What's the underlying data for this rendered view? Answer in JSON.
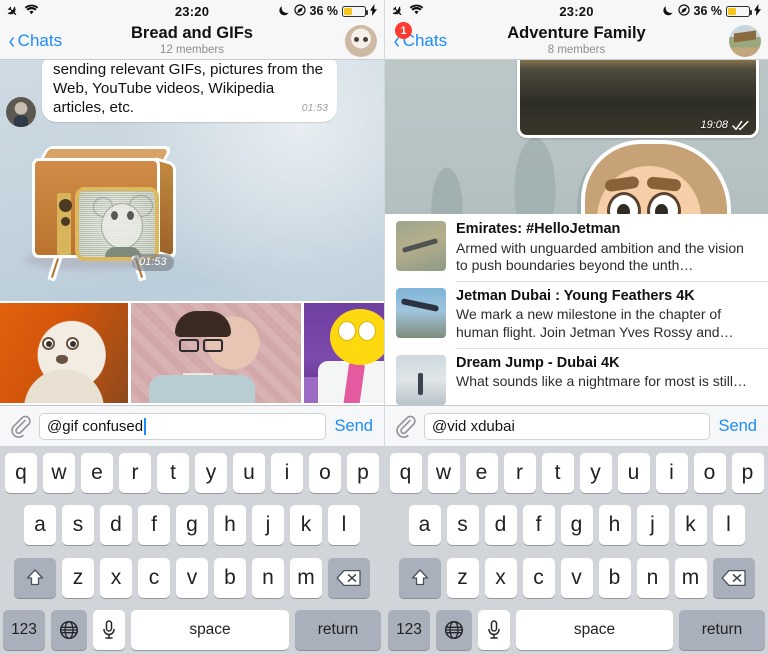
{
  "status_bar": {
    "airplane_icon": "airplane-icon",
    "wifi_icon": "wifi-icon",
    "time": "23:20",
    "moon_icon": "do-not-disturb-moon-icon",
    "location_icon": "location-services-icon",
    "battery_percent": "36 %",
    "battery_level": 36,
    "charging_icon": "lightning-bolt-icon"
  },
  "colors": {
    "accent_blue": "#1b8bf9",
    "badge_red": "#ff3b30",
    "battery_yellow": "#f5c518",
    "keyboard_bg": "#d1d4d9",
    "key_dark": "#a9b0bb"
  },
  "left_panel": {
    "nav": {
      "back_label": "Chats",
      "title": "Bread and GIFs",
      "subtitle": "12 members",
      "avatar_name": "chat-avatar-cat"
    },
    "message": {
      "text": "sending relevant GIFs, pictures from the Web, YouTube videos, Wikipedia articles, etc.",
      "time": "01:53",
      "sender_avatar": "sender-avatar-durov"
    },
    "sticker": {
      "name": "tv-sticker",
      "time": "01:53",
      "sender_avatar": "sender-avatar-blue"
    },
    "gif_results": [
      {
        "label": "gif-result-surprised-cat"
      },
      {
        "label": "gif-result-confused-man"
      },
      {
        "label": "gif-result-homer-simpson"
      }
    ],
    "input": {
      "attach_icon": "paperclip-icon",
      "value": "@gif confused",
      "placeholder": "Message",
      "send_label": "Send"
    }
  },
  "right_panel": {
    "nav": {
      "back_label": "Chats",
      "badge_count": "1",
      "title": "Adventure Family",
      "subtitle": "8 members",
      "avatar_name": "chat-avatar-hut"
    },
    "video_message": {
      "time": "19:08",
      "read_receipt": "double-check-icon"
    },
    "sticker": {
      "name": "bearded-guy-sticker"
    },
    "bot_results": [
      {
        "title": "Emirates: #HelloJetman",
        "description": "Armed with unguarded ambition and the vision to push boundaries beyond the unth…",
        "thumb": "thumb-jet-desert"
      },
      {
        "title": "Jetman Dubai : Young Feathers 4K",
        "description": "We mark a new milestone in the chapter of human flight. Join Jetman Yves Rossy and…",
        "thumb": "thumb-jetman-sky"
      },
      {
        "title": "Dream Jump - Dubai 4K",
        "description": "What sounds like a nightmare for most is still…",
        "thumb": "thumb-skydive"
      }
    ],
    "input": {
      "attach_icon": "paperclip-icon",
      "value": "@vid xdubai",
      "placeholder": "Message",
      "send_label": "Send"
    }
  },
  "keyboard": {
    "row1": [
      "q",
      "w",
      "e",
      "r",
      "t",
      "y",
      "u",
      "i",
      "o",
      "p"
    ],
    "row2": [
      "a",
      "s",
      "d",
      "f",
      "g",
      "h",
      "j",
      "k",
      "l"
    ],
    "row3": [
      "z",
      "x",
      "c",
      "v",
      "b",
      "n",
      "m"
    ],
    "shift_icon": "⇧",
    "backspace_icon": "⌫",
    "numbers_label": "123",
    "globe_icon": "🌐",
    "mic_icon": "🎤",
    "space_label": "space",
    "return_label": "return"
  }
}
